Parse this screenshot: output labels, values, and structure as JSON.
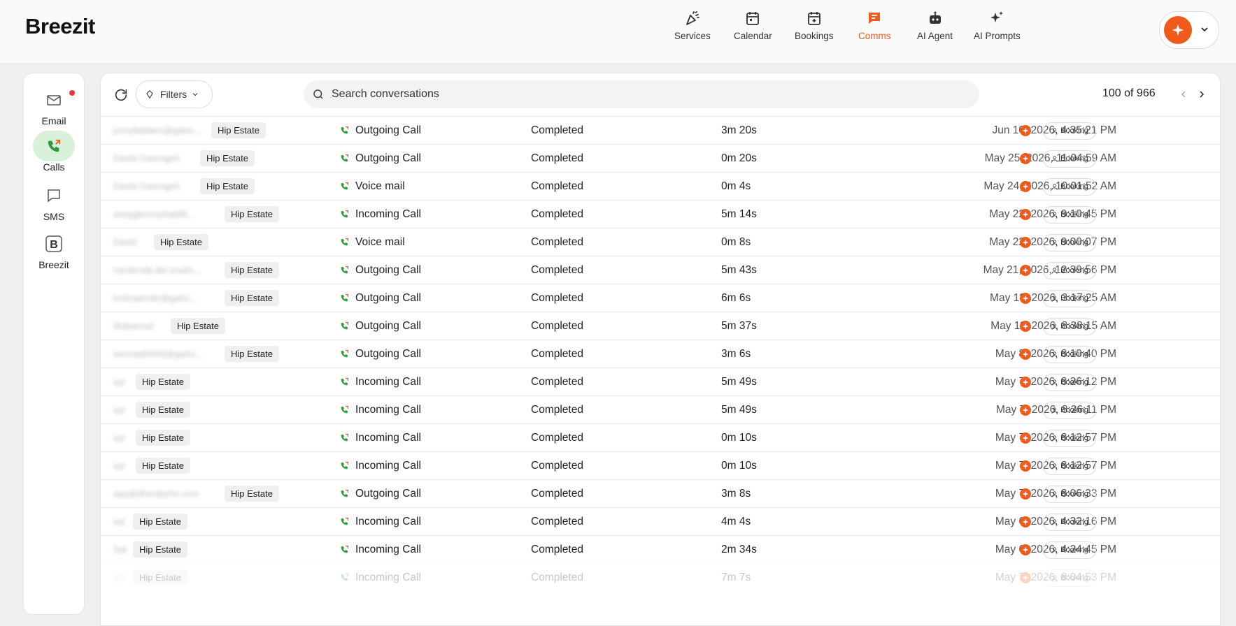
{
  "app": {
    "name": "Breezit"
  },
  "nav": [
    {
      "id": "services",
      "label": "Services",
      "icon": "party-popper-icon",
      "active": false
    },
    {
      "id": "calendar",
      "label": "Calendar",
      "icon": "calendar-icon",
      "active": false
    },
    {
      "id": "bookings",
      "label": "Bookings",
      "icon": "calendar-plus-icon",
      "active": false
    },
    {
      "id": "comms",
      "label": "Comms",
      "icon": "chat-icon",
      "active": true
    },
    {
      "id": "ai-agent",
      "label": "AI Agent",
      "icon": "robot-icon",
      "active": false
    },
    {
      "id": "ai-prompts",
      "label": "AI Prompts",
      "icon": "sparkles-icon",
      "active": false
    }
  ],
  "sidebar": {
    "items": [
      {
        "id": "email",
        "label": "Email",
        "icon": "mail-icon",
        "active": false,
        "notification": true
      },
      {
        "id": "calls",
        "label": "Calls",
        "icon": "phone-icon",
        "active": true,
        "notification": false
      },
      {
        "id": "sms",
        "label": "SMS",
        "icon": "message-icon",
        "active": false,
        "notification": false
      },
      {
        "id": "breezit",
        "label": "Breezit",
        "icon": "breezit-b-icon",
        "active": false,
        "notification": false
      }
    ]
  },
  "toolbar": {
    "filters_label": "Filters",
    "search_placeholder": "Search conversations",
    "pagination": "100 of 966"
  },
  "colors": {
    "accent": "#f05a1a",
    "call_green": "#2e9b3e",
    "active_bg": "#d9f1d9"
  },
  "rows": [
    {
      "contact": "prmyfadders@gaho...",
      "tag": "Hip Estate",
      "type": "Outgoing Call",
      "status": "Completed",
      "duration": "3m 20s",
      "date": "Jun 10, 2026, 4:35:21 PM",
      "action": "Booking"
    },
    {
      "contact": "David Garengeh",
      "tag": "Hip Estate",
      "type": "Outgoing Call",
      "status": "Completed",
      "duration": "0m 20s",
      "date": "May 25, 2026, 11:04:59 AM",
      "action": "Booking"
    },
    {
      "contact": "David Garengeh",
      "tag": "Hip Estate",
      "type": "Voice mail",
      "status": "Completed",
      "duration": "0m 4s",
      "date": "May 24, 2026, 10:01:52 AM",
      "action": "Booking"
    },
    {
      "contact": "antajgbmrsyhablfit...",
      "tag": "Hip Estate",
      "type": "Incoming Call",
      "status": "Completed",
      "duration": "5m 14s",
      "date": "May 22, 2026, 9:10:45 PM",
      "action": "Booking"
    },
    {
      "contact": "David",
      "tag": "Hip Estate",
      "type": "Voice mail",
      "status": "Completed",
      "duration": "0m 8s",
      "date": "May 22, 2026, 9:00:07 PM",
      "action": "Booking"
    },
    {
      "contact": "nacilenda.del.soulin...",
      "tag": "Hip Estate",
      "type": "Outgoing Call",
      "status": "Completed",
      "duration": "5m 43s",
      "date": "May 21, 2026, 12:39:56 PM",
      "action": "Booking"
    },
    {
      "contact": "lortizaamah@gaho...",
      "tag": "Hip Estate",
      "type": "Outgoing Call",
      "status": "Completed",
      "duration": "6m 6s",
      "date": "May 18, 2026, 3:17:25 AM",
      "action": "Booking"
    },
    {
      "contact": "Mukamud",
      "tag": "Hip Estate",
      "type": "Outgoing Call",
      "status": "Completed",
      "duration": "5m 37s",
      "date": "May 11, 2026, 8:38:15 AM",
      "action": "Booking"
    },
    {
      "contact": "seoniad0006@gaho...",
      "tag": "Hip Estate",
      "type": "Outgoing Call",
      "status": "Completed",
      "duration": "3m 6s",
      "date": "May 8, 2026, 8:10:40 PM",
      "action": "Booking"
    },
    {
      "contact": "vpr",
      "tag": "Hip Estate",
      "type": "Incoming Call",
      "status": "Completed",
      "duration": "5m 49s",
      "date": "May 7, 2026, 8:26:12 PM",
      "action": "Booking"
    },
    {
      "contact": "vpr",
      "tag": "Hip Estate",
      "type": "Incoming Call",
      "status": "Completed",
      "duration": "5m 49s",
      "date": "May 7, 2026, 8:26:11 PM",
      "action": "Booking"
    },
    {
      "contact": "vpr",
      "tag": "Hip Estate",
      "type": "Incoming Call",
      "status": "Completed",
      "duration": "0m 10s",
      "date": "May 7, 2026, 8:12:57 PM",
      "action": "Booking"
    },
    {
      "contact": "vpr",
      "tag": "Hip Estate",
      "type": "Incoming Call",
      "status": "Completed",
      "duration": "0m 10s",
      "date": "May 7, 2026, 8:12:57 PM",
      "action": "Booking"
    },
    {
      "contact": "aqs@dhscbprhs.com",
      "tag": "Hip Estate",
      "type": "Outgoing Call",
      "status": "Completed",
      "duration": "3m 8s",
      "date": "May 7, 2026, 8:06:33 PM",
      "action": "Booking"
    },
    {
      "contact": "sal",
      "tag": "Hip Estate",
      "type": "Incoming Call",
      "status": "Completed",
      "duration": "4m 4s",
      "date": "May 6, 2026, 4:32:16 PM",
      "action": "Booking"
    },
    {
      "contact": "Sal",
      "tag": "Hip Estate",
      "type": "Incoming Call",
      "status": "Completed",
      "duration": "2m 34s",
      "date": "May 6, 2026, 4:24:45 PM",
      "action": "Booking"
    },
    {
      "contact": "sal",
      "tag": "Hip Estate",
      "type": "Incoming Call",
      "status": "Completed",
      "duration": "7m 7s",
      "date": "May 7, 2026, 8:04:53 PM",
      "action": "Booking",
      "faded": true
    }
  ]
}
